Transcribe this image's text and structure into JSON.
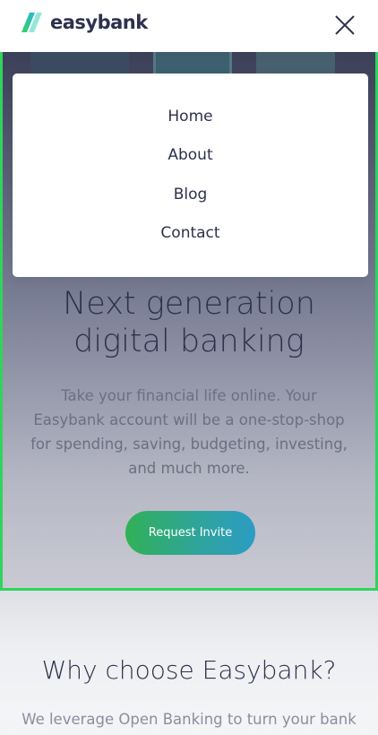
{
  "brand": {
    "name": "easybank"
  },
  "menu": {
    "items": [
      {
        "label": "Home"
      },
      {
        "label": "About"
      },
      {
        "label": "Blog"
      },
      {
        "label": "Contact"
      }
    ]
  },
  "hero": {
    "title_line1": "Next generation",
    "title_line2": "digital banking",
    "text_line1": "Take your financial life online. Your",
    "text_line2": "Easybank account will be a one-stop-shop",
    "text_line3": "for spending, saving, budgeting, investing,",
    "text_line4": "and much more.",
    "cta_label": "Request Invite"
  },
  "why": {
    "title": "Why choose Easybank?",
    "text": "We leverage Open Banking to turn your bank"
  },
  "colors": {
    "dark_blue": "#2d314d",
    "lime_green": "#31d35c",
    "bright_cyan": "#2bb7da",
    "grayish_blue": "#9698a6"
  },
  "icons": {
    "close": "close-icon",
    "logo": "logo-mark-icon"
  }
}
